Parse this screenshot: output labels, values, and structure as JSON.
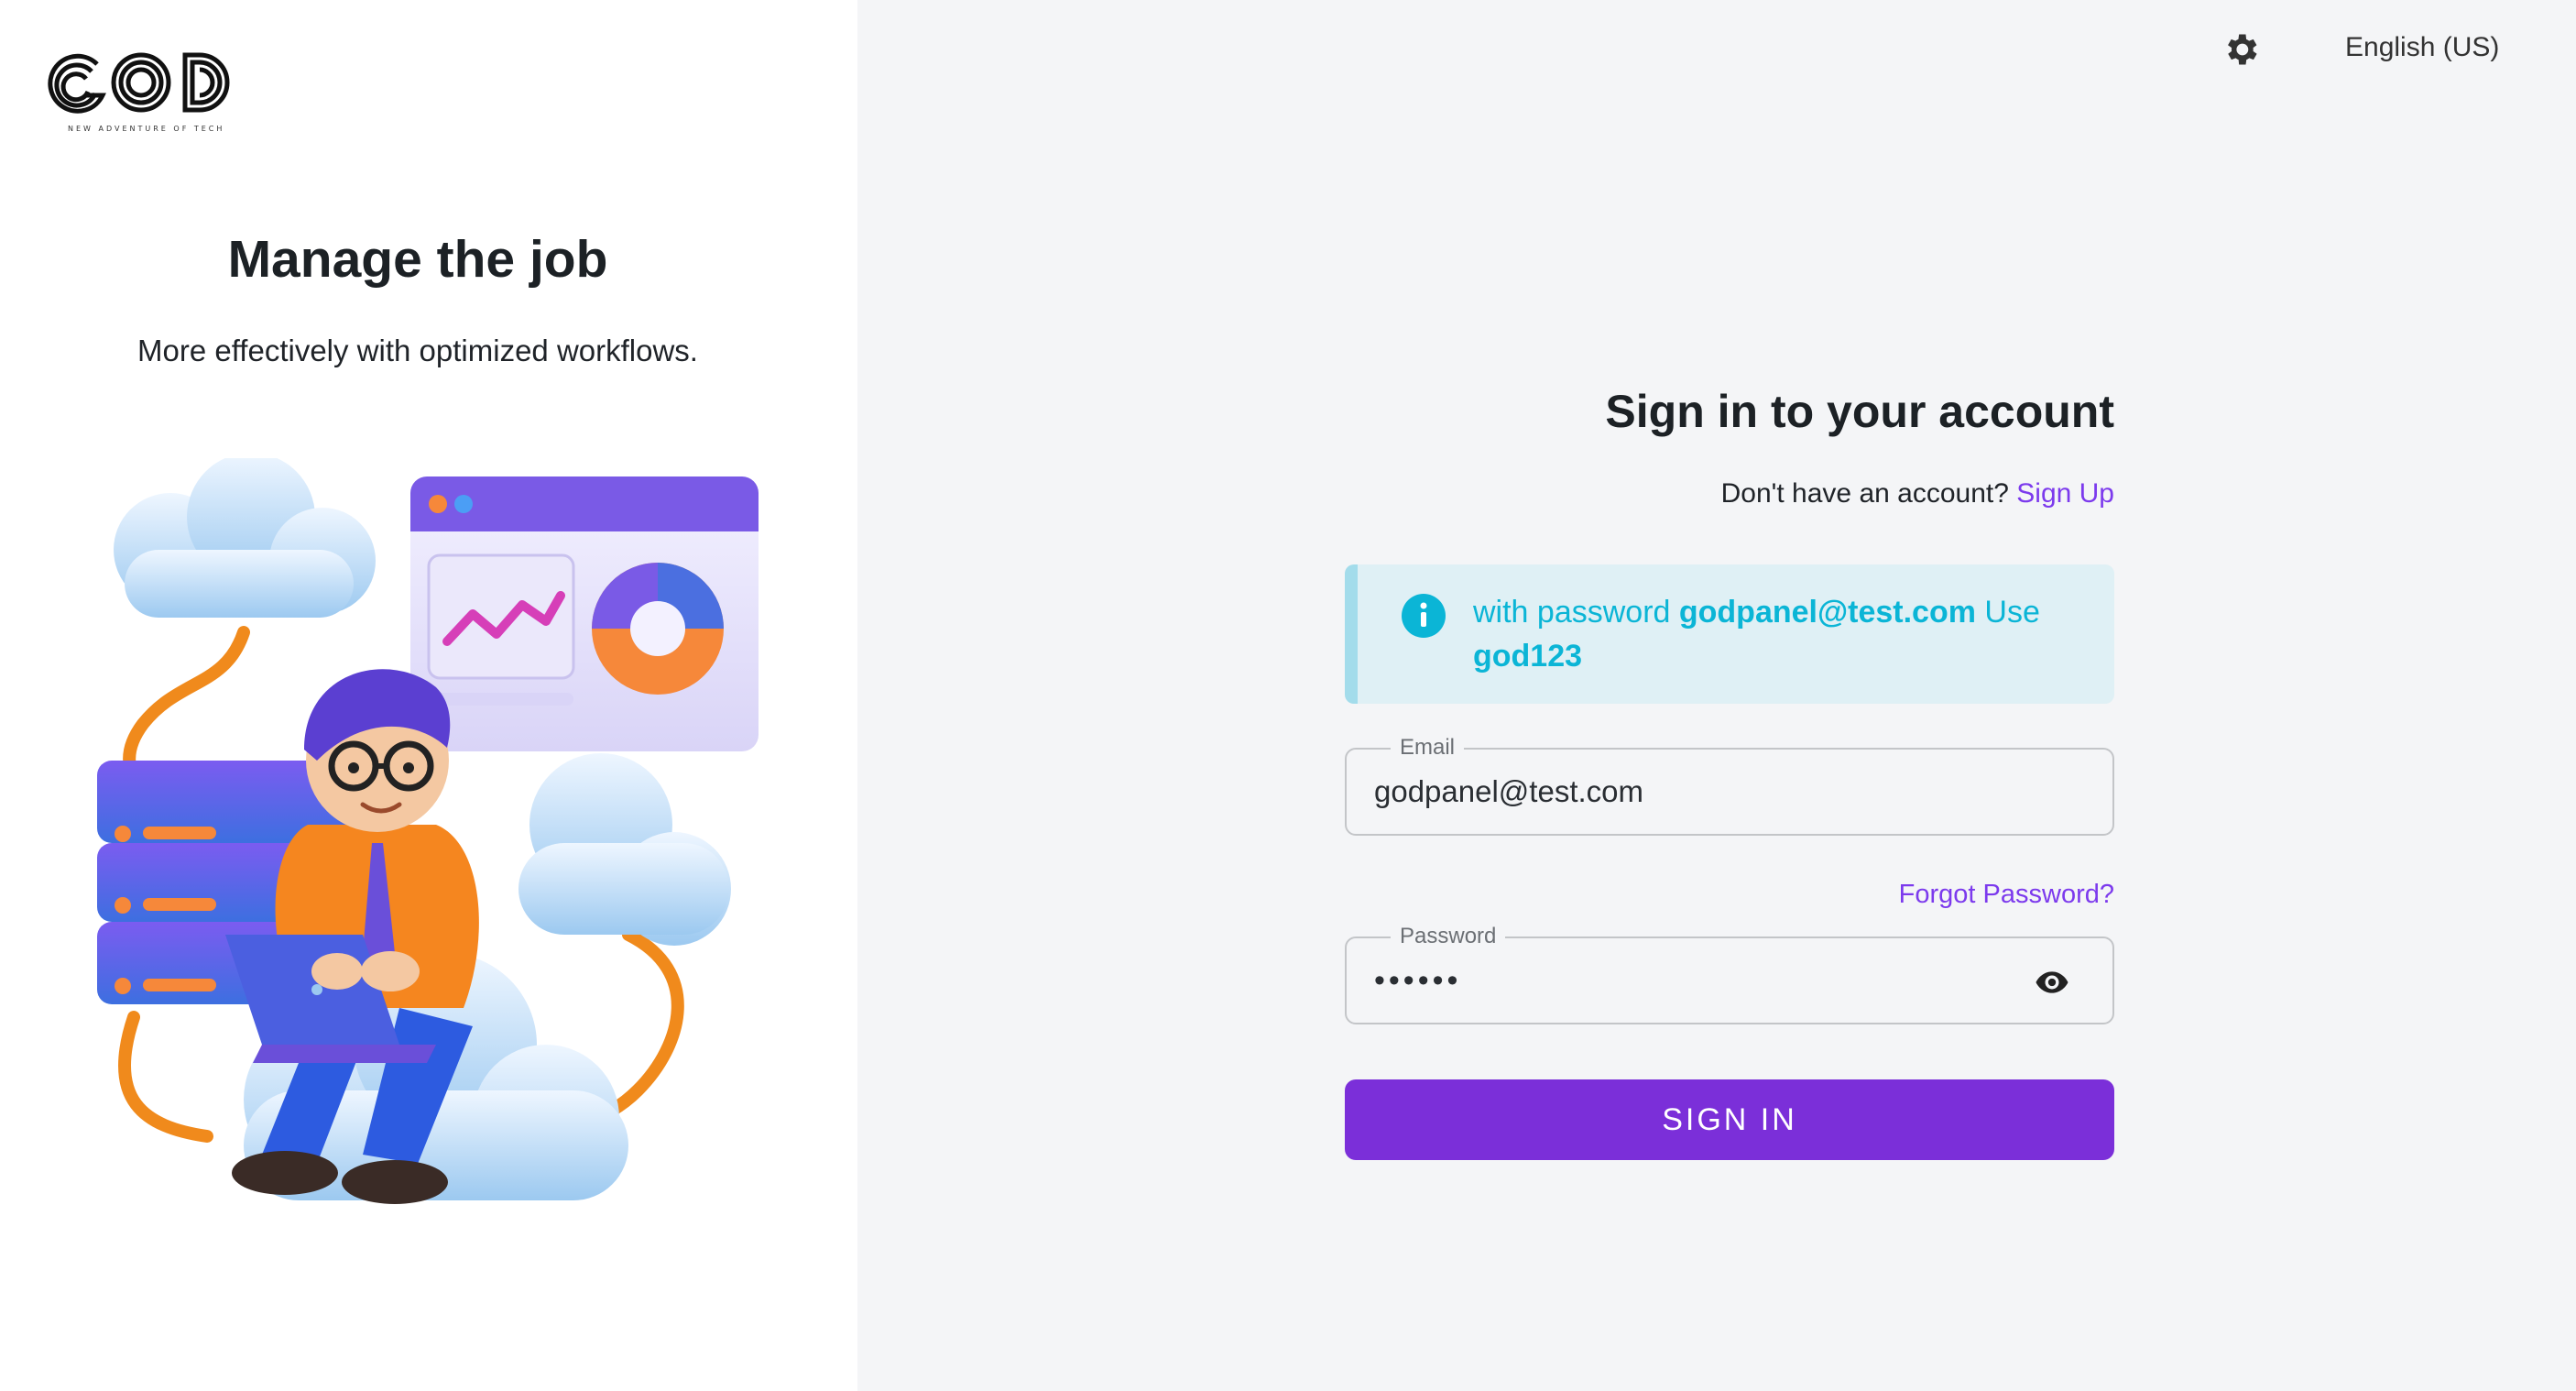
{
  "brand": {
    "logo_text": "GOD",
    "tagline": "NEW ADVENTURE OF TECH"
  },
  "hero": {
    "title": "Manage the job",
    "subtitle": "More effectively with optimized workflows."
  },
  "topbar": {
    "settings_icon": "gear-icon",
    "language": "English (US)"
  },
  "form": {
    "title": "Sign in to your account",
    "no_account_text": "Don't have an account?",
    "signup_label": "Sign Up",
    "alert": {
      "prefix": "with password",
      "email": "godpanel@test.com",
      "middle": "Use",
      "password": "god123",
      "icon": "info-icon"
    },
    "email": {
      "label": "Email",
      "value": "godpanel@test.com"
    },
    "forgot_label": "Forgot Password?",
    "password": {
      "label": "Password",
      "value": "••••••",
      "toggle_icon": "eye-icon"
    },
    "submit_label": "SIGN IN"
  },
  "colors": {
    "accent": "#7b2fd9",
    "link": "#7c3aed",
    "info": "#0bb5d6",
    "info_bg": "#dff0f5",
    "left_bg": "#ffffff",
    "right_bg": "#f4f5f7"
  }
}
